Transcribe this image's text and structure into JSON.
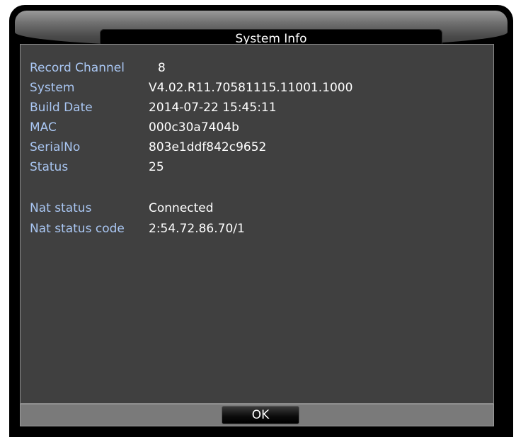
{
  "dialog": {
    "title": "System Info",
    "ok_label": "OK"
  },
  "info": {
    "record_channel": {
      "label": "Record Channel",
      "value": "8"
    },
    "system": {
      "label": "System",
      "value": "V4.02.R11.70581115.11001.1000"
    },
    "build_date": {
      "label": "Build Date",
      "value": "2014-07-22 15:45:11"
    },
    "mac": {
      "label": "MAC",
      "value": "000c30a7404b"
    },
    "serial_no": {
      "label": "SerialNo",
      "value": "803e1ddf842c9652"
    },
    "status": {
      "label": "Status",
      "value": "25"
    },
    "nat_status": {
      "label": "Nat status",
      "value": "Connected"
    },
    "nat_status_code": {
      "label": "Nat status code",
      "value": "2:54.72.86.70/1"
    }
  },
  "colors": {
    "label": "#a9c6f2",
    "value": "#ffffff",
    "panel": "#404040",
    "frame": "#000000"
  }
}
